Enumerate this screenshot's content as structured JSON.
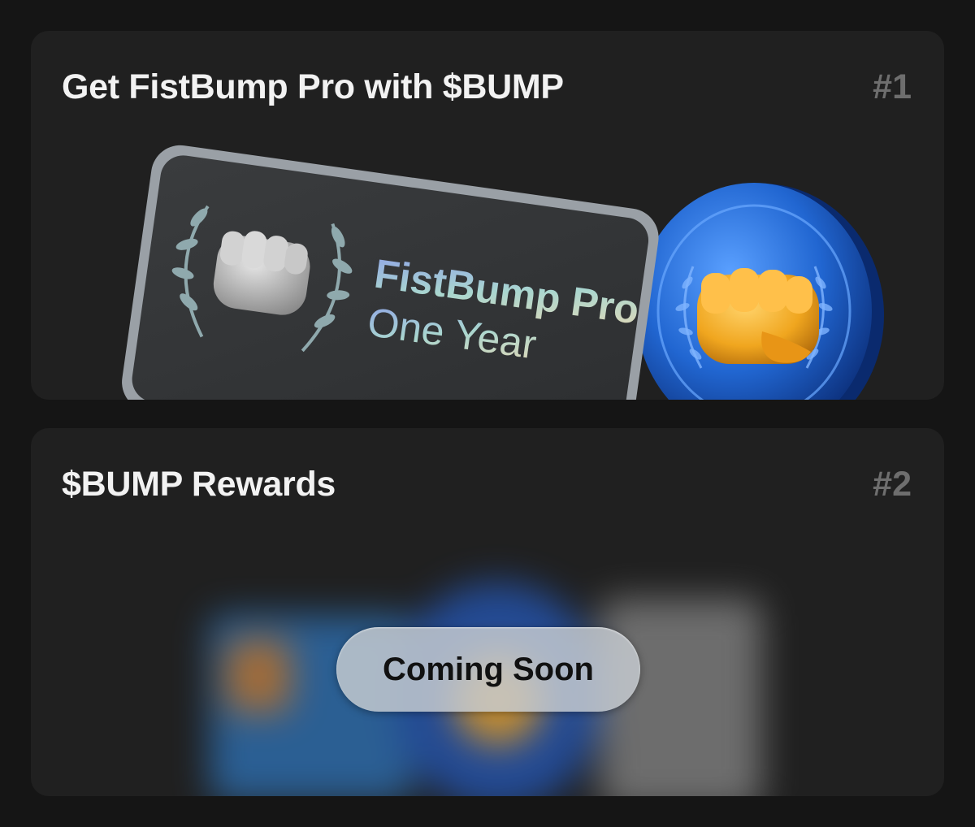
{
  "cards": [
    {
      "title": "Get FistBump Pro with $BUMP",
      "rank": "#1",
      "ticket": {
        "line1": "FistBump Pro",
        "line2": "One Year"
      }
    },
    {
      "title": "$BUMP Rewards",
      "rank": "#2",
      "badge": "Coming Soon"
    }
  ],
  "icons": {
    "fist": "fist-bump-icon",
    "laurel": "laurel-wreath-icon",
    "coin": "bump-coin-icon"
  },
  "colors": {
    "background": "#151515",
    "card": "#202020",
    "title": "#f2f2f2",
    "rank": "#6e6e6e",
    "coin": "#2b6fd6",
    "fist_gold": "#f0a61f"
  }
}
